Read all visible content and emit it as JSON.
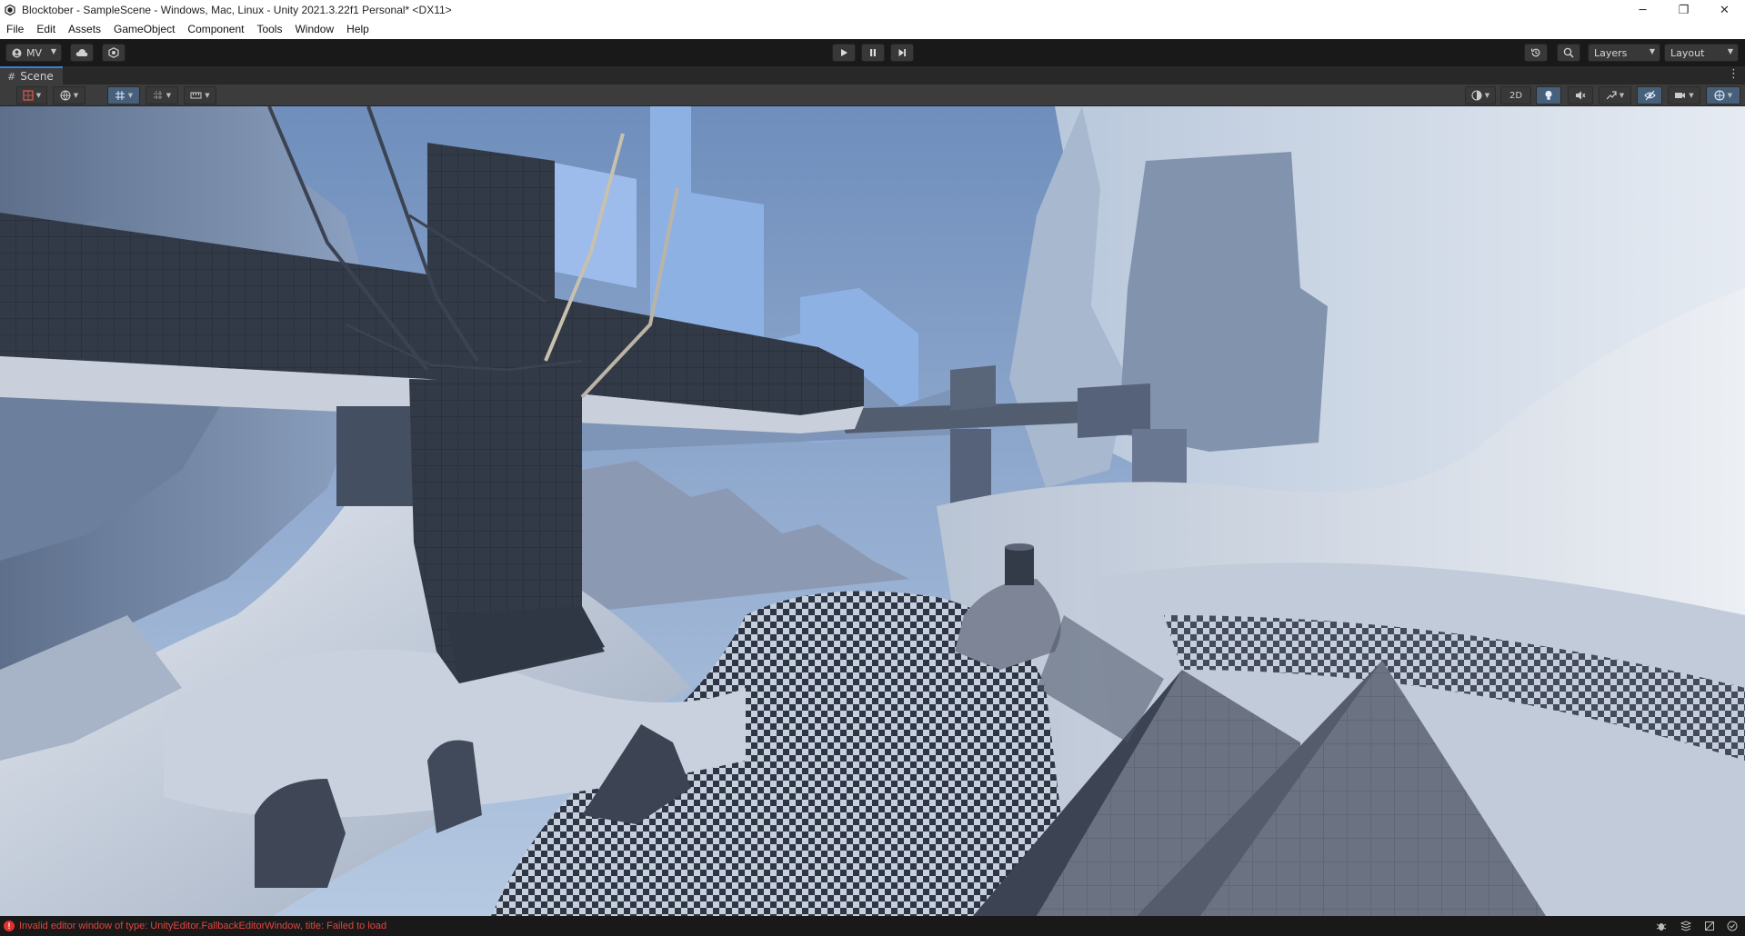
{
  "window": {
    "title": "Blocktober - SampleScene - Windows, Mac, Linux - Unity 2021.3.22f1 Personal* <DX11>",
    "minimize": "─",
    "maximize": "❐",
    "close": "✕"
  },
  "menu": [
    "File",
    "Edit",
    "Assets",
    "GameObject",
    "Component",
    "Tools",
    "Window",
    "Help"
  ],
  "toolbar": {
    "account_label": "MV",
    "layers_label": "Layers",
    "layout_label": "Layout"
  },
  "scene_tab": {
    "label": "Scene",
    "mode_2d_label": "2D"
  },
  "status": {
    "error_icon": "!",
    "message": "Invalid editor window of type: UnityEditor.FallbackEditorWindow, title: Failed to load"
  },
  "icons": {
    "account": "account-icon",
    "cloud": "cloud-icon",
    "collab": "collab-icon",
    "play": "play-icon",
    "pause": "pause-icon",
    "step": "step-icon",
    "history": "history-icon",
    "search": "search-icon"
  },
  "colors": {
    "accent": "#3a7bd5",
    "error": "#e0453f",
    "toolbar_bg": "#191919",
    "panel_bg": "#3c3c3c"
  }
}
